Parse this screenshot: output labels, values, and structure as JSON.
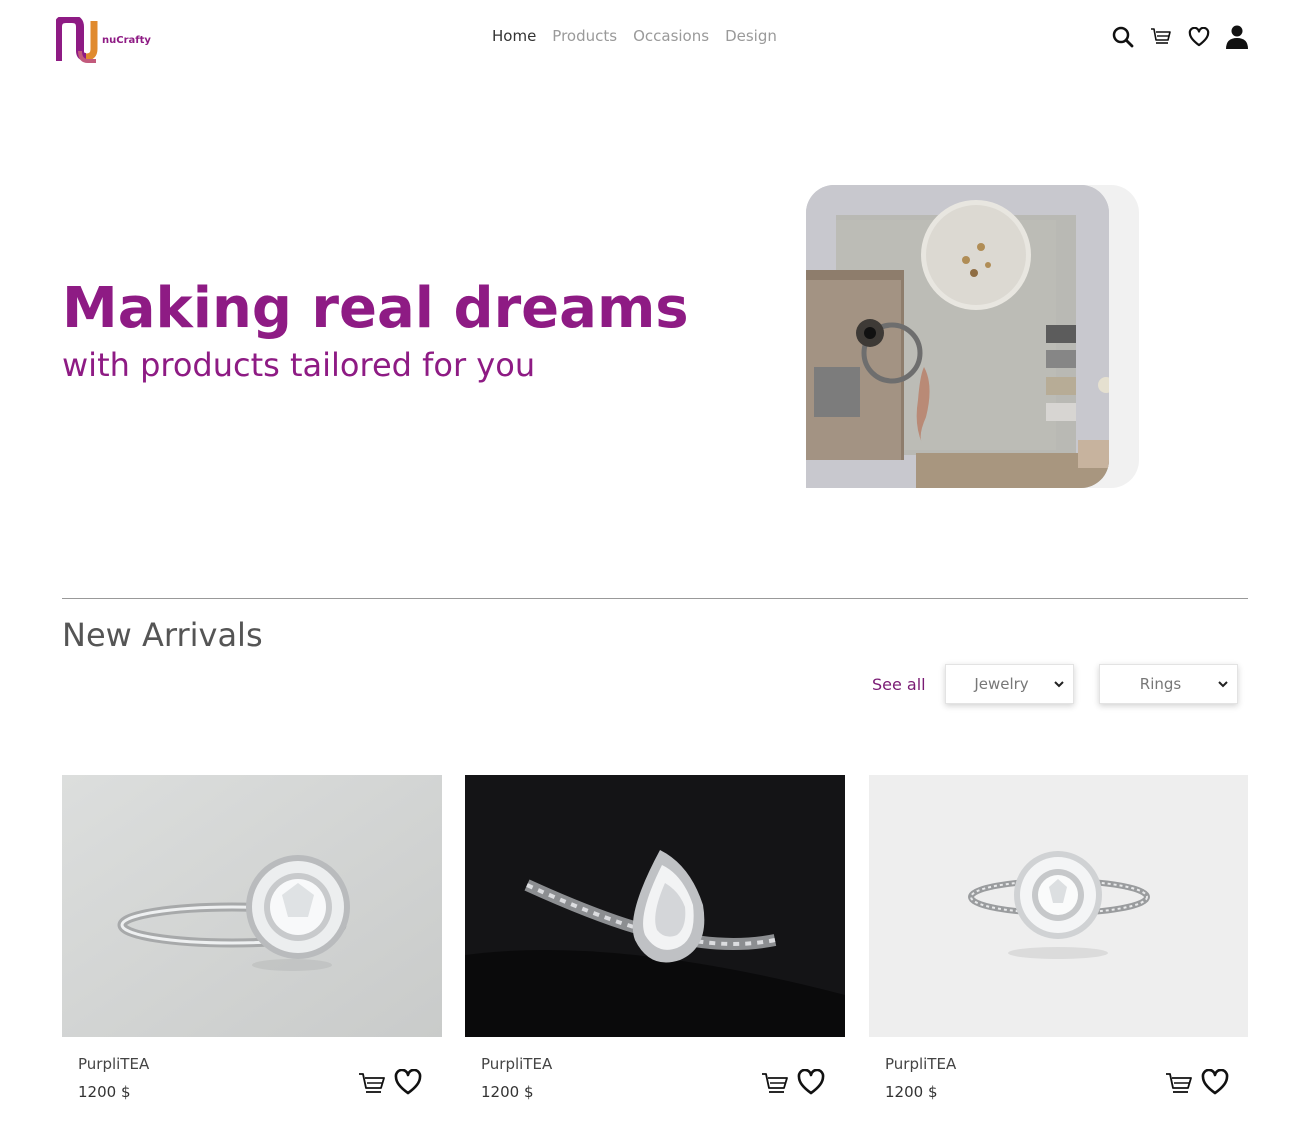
{
  "brand": {
    "logo_text": "nuCrafty",
    "colors": {
      "primary": "#8e1b84",
      "accent": "#e08a2e",
      "link": "#7a1b74"
    }
  },
  "nav": {
    "items": [
      {
        "label": "Home",
        "active": true
      },
      {
        "label": "Products",
        "active": false
      },
      {
        "label": "Occasions",
        "active": false
      },
      {
        "label": "Design",
        "active": false
      }
    ]
  },
  "header_icons": [
    "search-icon",
    "cart-icon",
    "heart-icon",
    "user-icon"
  ],
  "hero": {
    "title": "Making real dreams",
    "subtitle": "with products tailored for you",
    "image": "moodboard-image"
  },
  "arrivals": {
    "title": "New Arrivals",
    "see_all": "See all",
    "filter_category": {
      "selected": "Jewelry"
    },
    "filter_subcategory": {
      "selected": "Rings"
    },
    "products": [
      {
        "name": "PurpliTEA",
        "price": "1200 $",
        "image": "halo-ring-image"
      },
      {
        "name": "PurpliTEA",
        "price": "1200 $",
        "image": "pear-ring-image"
      },
      {
        "name": "PurpliTEA",
        "price": "1200 $",
        "image": "flower-ring-image"
      }
    ]
  }
}
